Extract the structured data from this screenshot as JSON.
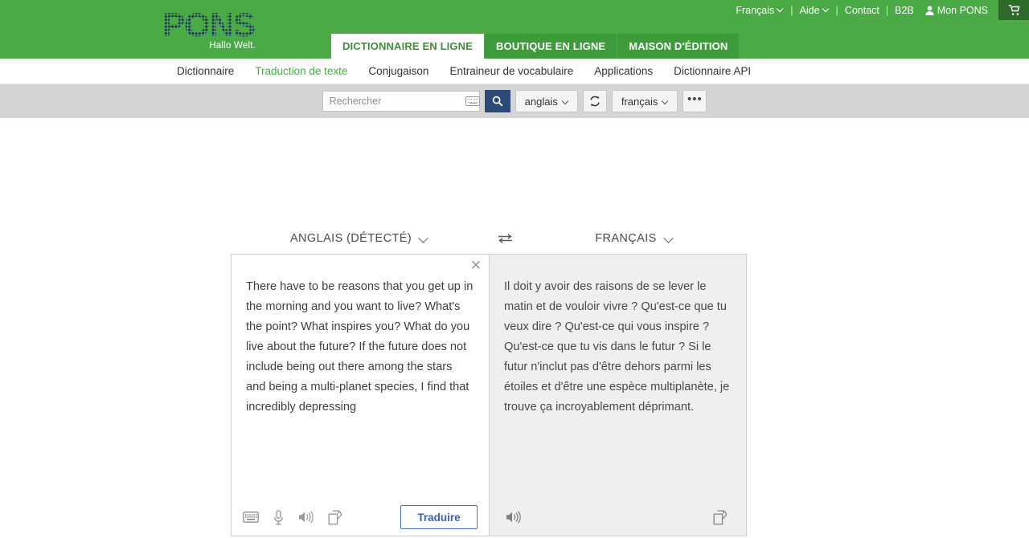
{
  "brand": {
    "logo_text": "PONS",
    "tagline": "Hallo Welt.",
    "logo_color": "#1d2f5f",
    "header_green": "#4aab46",
    "cart_green": "#2d6b2b"
  },
  "top_nav": {
    "items": [
      {
        "label": "Français",
        "has_chevron": true
      },
      {
        "label": "|",
        "separator": true
      },
      {
        "label": "Aide",
        "has_chevron": true
      },
      {
        "label": "|",
        "separator": true
      },
      {
        "label": "Contact",
        "has_chevron": false
      },
      {
        "label": "|",
        "separator": true
      },
      {
        "label": "B2B",
        "has_chevron": false
      }
    ],
    "account_icon": "person-icon",
    "account_label": "Mon PONS",
    "cart_icon": "shopping-cart-icon"
  },
  "main_tabs": [
    {
      "label": "DICTIONNAIRE EN LIGNE",
      "active": true
    },
    {
      "label": "BOUTIQUE EN LIGNE",
      "active": false
    },
    {
      "label": "MAISON D'ÉDITION",
      "active": false
    }
  ],
  "sub_nav": [
    {
      "label": "Dictionnaire",
      "active": false
    },
    {
      "label": "Traduction de texte",
      "active": true
    },
    {
      "label": "Conjugaison",
      "active": false
    },
    {
      "label": "Entraineur de vocabulaire",
      "active": false
    },
    {
      "label": "Applications",
      "active": false
    },
    {
      "label": "Dictionnaire API",
      "active": false
    }
  ],
  "search": {
    "placeholder": "Rechercher",
    "value": "",
    "keyboard_icon": "keyboard-icon",
    "search_icon": "search-icon",
    "source_lang": "anglais",
    "swap_icon": "swap-languages-icon",
    "target_lang": "français",
    "more_label": "•••",
    "button_color": "#2b4a78"
  },
  "translator": {
    "source_language": "ANGLAIS (DÉTECTÉ)",
    "target_language": "FRANÇAIS",
    "swap_icon": "swap-arrows-icon",
    "source_text": "There have to be reasons that you get up in the morning and you want to live? What's the point? What inspires you? What do you live about the future? If the future does not include being out there among the stars and being a multi-planet species, I find that incredibly depressing",
    "target_text": "Il doit y avoir des raisons de se lever le matin et de vouloir vivre ? Qu'est-ce que tu veux dire ? Qu'est-ce qui vous inspire ? Qu'est-ce que tu vis dans le futur ? Si le futur n'inclut pas d'être dehors parmi les étoiles et d'être une espèce multiplanète, je trouve ça incroyablement déprimant.",
    "clear_icon": "close-icon",
    "source_tools": [
      {
        "icon": "keyboard-icon"
      },
      {
        "icon": "microphone-icon"
      },
      {
        "icon": "speaker-icon"
      },
      {
        "icon": "copy-icon"
      }
    ],
    "translate_button": "Traduire",
    "translate_button_color": "#4a72b8",
    "target_tools": [
      {
        "icon": "speaker-icon"
      },
      {
        "icon": "copy-icon"
      }
    ]
  }
}
